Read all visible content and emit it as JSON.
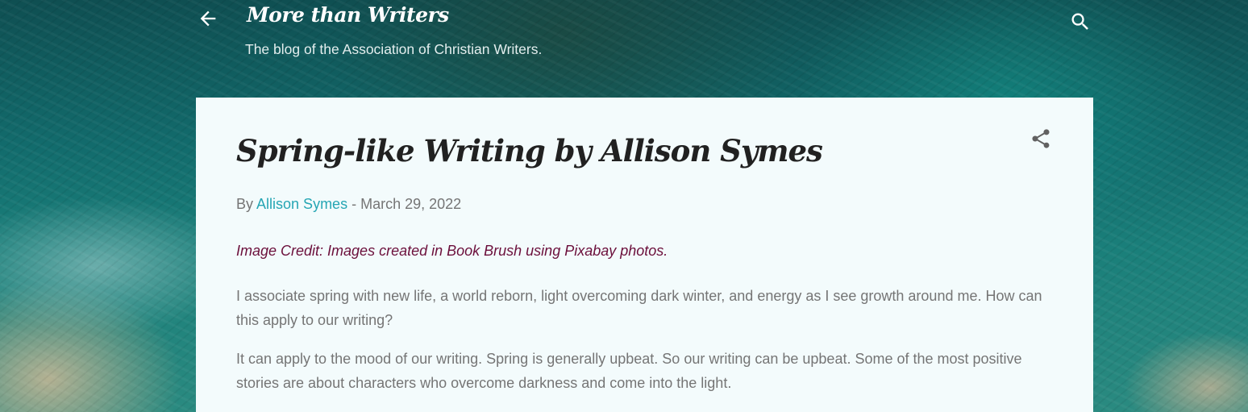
{
  "header": {
    "blog_title": "More than Writers",
    "description": "The blog of the Association of Christian Writers.",
    "back_icon": "arrow-left-icon",
    "search_icon": "search-icon"
  },
  "post": {
    "title": "Spring-like Writing by Allison Symes",
    "share_icon": "share-icon",
    "byline": {
      "by": "By",
      "author": "Allison Symes",
      "separator": "-",
      "date": "March 29, 2022"
    },
    "image_credit": "Image Credit:  Images created in Book Brush using Pixabay photos.",
    "paragraphs": [
      "I associate spring with new life, a world reborn, light overcoming dark winter, and energy as I see growth around me. How can this apply to our writing?",
      "It can apply to the mood of our writing. Spring is generally upbeat. So our writing can be upbeat. Some of the most positive stories are about characters who overcome darkness and come into the light."
    ]
  },
  "colors": {
    "card_background": "#f3fbfc",
    "title_text": "#212121",
    "body_text": "#757575",
    "link": "#26a6b4",
    "credit_text": "#6b0f3b",
    "header_text": "#ffffff"
  }
}
